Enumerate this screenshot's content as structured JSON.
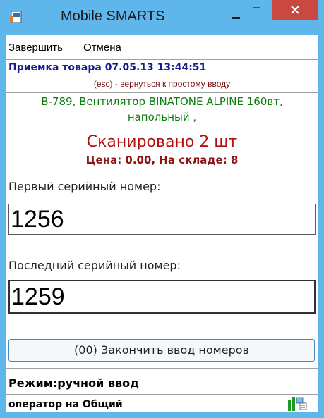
{
  "window": {
    "title": "Mobile SMARTS",
    "icons": {
      "app": "app-icon",
      "minimize": "minimize-icon",
      "maximize": "maximize-icon",
      "close": "close-icon"
    },
    "colors": {
      "titlebar": "#5fb6ea",
      "close": "#c94840"
    }
  },
  "menu": {
    "items": [
      {
        "label": "Завершить"
      },
      {
        "label": "Отмена"
      }
    ]
  },
  "document": {
    "header": "Приемка товара 07.05.13 13:44:51",
    "hint": "(esc) - вернуться к простому вводу"
  },
  "product": {
    "name_line1": "B-789, Вентилятор BINATONE ALPINE 160вт,",
    "name_line2": "напольный ,",
    "scanned": "Сканировано 2 шт",
    "price_stock": "Цена: 0.00, На складе: 8",
    "colors": {
      "name": "#0b7d0b",
      "scanned": "#b01010",
      "price": "#8e1414"
    }
  },
  "form": {
    "first_label": "Первый серийный номер:",
    "first_value": "1256",
    "last_label": "Последний серийный номер:",
    "last_value": "1259",
    "finish_button": "(00) Закончить ввод номеров"
  },
  "status": {
    "mode": "Режим:ручной ввод",
    "operator": "оператор на Общий",
    "icon": "signal-icon"
  }
}
